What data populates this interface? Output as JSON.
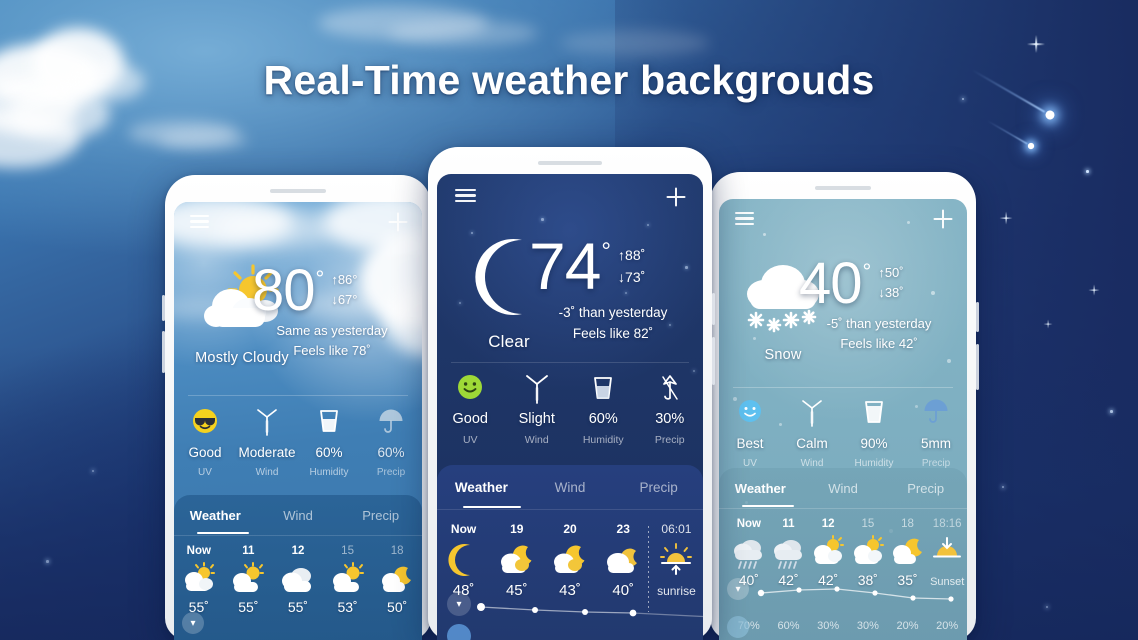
{
  "headline": "Real-Time weather backgrouds",
  "phones": [
    {
      "id": "left",
      "theme_color": "#4f8fc4",
      "condition": "Mostly Cloudy",
      "condition_icon": "sun-behind-cloud-icon",
      "temperature": "80",
      "degree": "°",
      "high": "↑86°",
      "low": "↓67°",
      "high_value": "86",
      "low_value": "67",
      "comparison": "Same as yesterday",
      "feels_like": "Feels like 78˚",
      "metrics": [
        {
          "value": "Good",
          "label": "UV",
          "icon": "sunglasses-face-icon"
        },
        {
          "value": "Moderate",
          "label": "Wind",
          "icon": "wind-turbine-icon"
        },
        {
          "value": "60%",
          "label": "Humidity",
          "icon": "water-glass-icon"
        },
        {
          "value": "60%",
          "label": "Precip",
          "icon": "umbrella-icon"
        }
      ],
      "tabs": [
        {
          "label": "Weather",
          "active": true
        },
        {
          "label": "Wind",
          "active": false
        },
        {
          "label": "Precip",
          "active": false
        }
      ],
      "hours": [
        {
          "time": "Now",
          "temp": "55˚",
          "icon": "sun-cloud-icon"
        },
        {
          "time": "11",
          "temp": "55˚",
          "icon": "sun-cloud-icon"
        },
        {
          "time": "12",
          "temp": "55˚",
          "icon": "cloud-icon"
        },
        {
          "time": "15",
          "temp": "53˚",
          "icon": "sun-cloud-icon"
        },
        {
          "time": "18",
          "temp": "50˚",
          "icon": "moon-cloud-icon"
        }
      ]
    },
    {
      "id": "center",
      "theme_color": "#1e3566",
      "condition": "Clear",
      "condition_icon": "crescent-moon-icon",
      "temperature": "74",
      "degree": "°",
      "high": "↑88˚",
      "low": "↓73˚",
      "high_value": "88",
      "low_value": "73",
      "comparison": "-3˚ than yesterday",
      "feels_like": "Feels like 82˚",
      "metrics": [
        {
          "value": "Good",
          "label": "UV",
          "icon": "smiley-face-icon"
        },
        {
          "value": "Slight",
          "label": "Wind",
          "icon": "wind-turbine-icon"
        },
        {
          "value": "60%",
          "label": "Humidity",
          "icon": "water-glass-icon"
        },
        {
          "value": "30%",
          "label": "Precip",
          "icon": "umbrella-closed-icon"
        }
      ],
      "tabs": [
        {
          "label": "Weather",
          "active": true
        },
        {
          "label": "Wind",
          "active": false
        },
        {
          "label": "Precip",
          "active": false
        }
      ],
      "hours": [
        {
          "time": "Now",
          "temp": "48˚",
          "icon": "crescent-moon-icon"
        },
        {
          "time": "19",
          "temp": "45˚",
          "icon": "moon-cloud-icon"
        },
        {
          "time": "20",
          "temp": "43˚",
          "icon": "moon-cloud-icon"
        },
        {
          "time": "23",
          "temp": "40˚",
          "icon": "moon-cloud-icon"
        }
      ],
      "sun_event": {
        "time": "06:01",
        "label": "sunrise",
        "icon": "sunrise-icon"
      }
    },
    {
      "id": "right",
      "theme_color": "#7fb0c2",
      "condition": "Snow",
      "condition_icon": "snow-cloud-icon",
      "temperature": "40",
      "degree": "°",
      "high": "↑50˚",
      "low": "↓38˚",
      "high_value": "50",
      "low_value": "38",
      "comparison": "-5˚ than yesterday",
      "feels_like": "Feels like 42˚",
      "metrics": [
        {
          "value": "Best",
          "label": "UV",
          "icon": "smiley-face-icon"
        },
        {
          "value": "Calm",
          "label": "Wind",
          "icon": "wind-turbine-icon"
        },
        {
          "value": "90%",
          "label": "Humidity",
          "icon": "water-glass-icon"
        },
        {
          "value": "5mm",
          "label": "Precip",
          "icon": "umbrella-rain-icon"
        }
      ],
      "tabs": [
        {
          "label": "Weather",
          "active": true
        },
        {
          "label": "Wind",
          "active": false
        },
        {
          "label": "Precip",
          "active": false
        }
      ],
      "hours": [
        {
          "time": "Now",
          "temp": "40˚",
          "icon": "rain-cloud-icon",
          "precip": "70%"
        },
        {
          "time": "11",
          "temp": "42˚",
          "icon": "rain-cloud-icon",
          "precip": "60%"
        },
        {
          "time": "12",
          "temp": "42˚",
          "icon": "sun-cloud-icon",
          "precip": "30%"
        },
        {
          "time": "15",
          "temp": "38˚",
          "icon": "sun-cloud-icon",
          "precip": "30%"
        },
        {
          "time": "18",
          "temp": "35˚",
          "icon": "moon-cloud-icon",
          "precip": "20%"
        }
      ],
      "sun_event": {
        "time": "18:16",
        "label": "Sunset",
        "icon": "sunset-icon",
        "precip": "20%"
      }
    }
  ]
}
